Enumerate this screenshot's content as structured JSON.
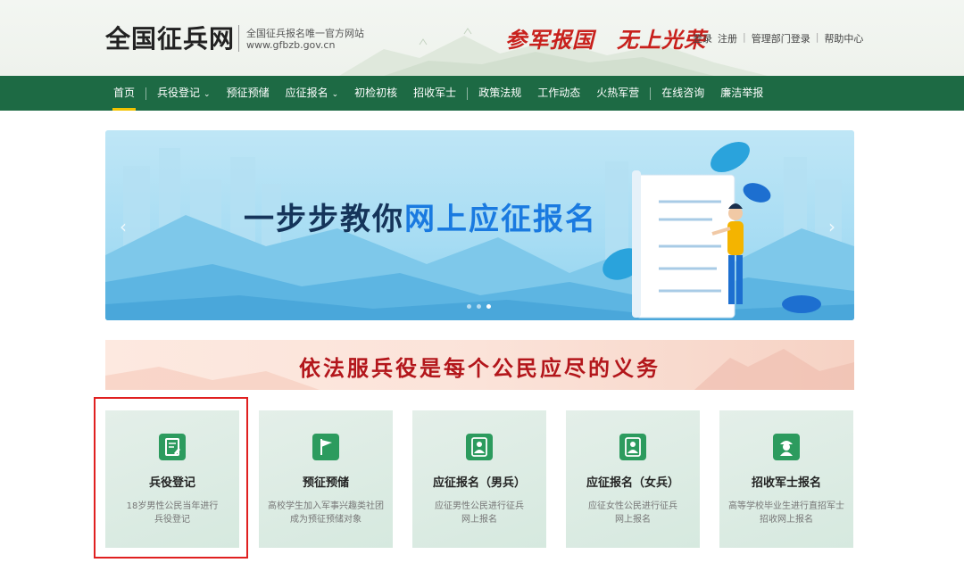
{
  "header": {
    "site_title": "全国征兵网",
    "site_subtitle": "全国征兵报名唯一官方网站",
    "site_url": "www.gfbzb.gov.cn",
    "slogan": "参军报国　无上光荣",
    "links": [
      "登录",
      "注册",
      "管理部门登录",
      "帮助中心"
    ]
  },
  "nav": {
    "items": [
      {
        "label": "首页"
      },
      {
        "label": "兵役登记"
      },
      {
        "label": "预征预储"
      },
      {
        "label": "应征报名"
      },
      {
        "label": "初检初核"
      },
      {
        "label": "招收军士"
      },
      {
        "label": "政策法规"
      },
      {
        "label": "工作动态"
      },
      {
        "label": "火热军营"
      },
      {
        "label": "在线咨询"
      },
      {
        "label": "廉洁举报"
      }
    ]
  },
  "banner": {
    "text_part1": "一步步教你",
    "text_part2": "网上应征报名",
    "prev_icon": "chevron-left-icon",
    "next_icon": "chevron-right-icon"
  },
  "strip": {
    "text": "依法服兵役是每个公民应尽的义务"
  },
  "cards": [
    {
      "title": "兵役登记",
      "desc_line1": "18岁男性公民当年进行",
      "desc_line2": "兵役登记",
      "icon": "registration-icon"
    },
    {
      "title": "预征预储",
      "desc_line1": "高校学生加入军事兴趣类社团",
      "desc_line2": "成为预征预储对象",
      "icon": "flag-icon"
    },
    {
      "title": "应征报名（男兵）",
      "desc_line1": "应征男性公民进行征兵",
      "desc_line2": "网上报名",
      "icon": "person-icon"
    },
    {
      "title": "应征报名（女兵）",
      "desc_line1": "应征女性公民进行征兵",
      "desc_line2": "网上报名",
      "icon": "person-icon"
    },
    {
      "title": "招收军士报名",
      "desc_line1": "高等学校毕业生进行直招军士",
      "desc_line2": "招收网上报名",
      "icon": "soldier-icon"
    }
  ],
  "colors": {
    "nav_green": "#1d6a44",
    "card_icon_green": "#2c9b5e",
    "accent_red": "#e02020"
  }
}
